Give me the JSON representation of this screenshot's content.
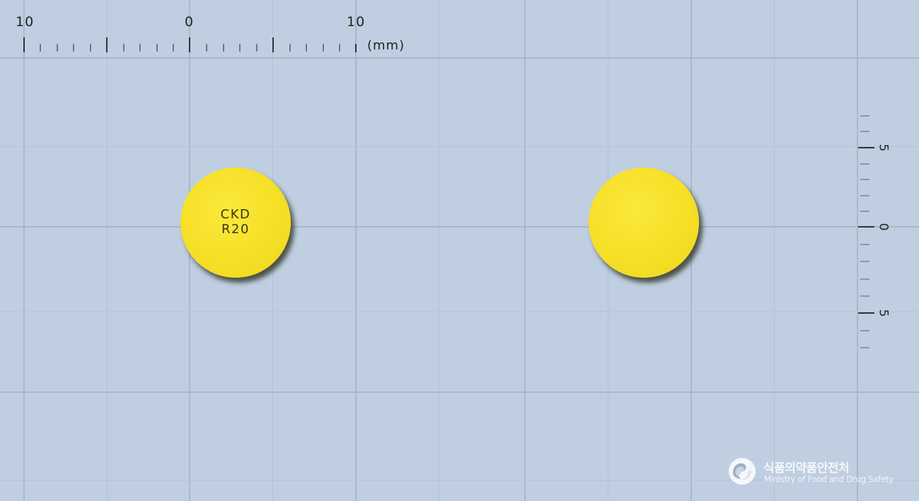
{
  "top_ruler": {
    "labels": [
      "10",
      "0",
      "10"
    ],
    "unit": "(mm)"
  },
  "side_ruler": {
    "labels": [
      "5",
      "0",
      "5"
    ]
  },
  "tablets": [
    {
      "imprint_line1": "CKD",
      "imprint_line2": "R20",
      "color": "#f6e027",
      "side": "front"
    },
    {
      "imprint_line1": "",
      "imprint_line2": "",
      "color": "#f6e027",
      "side": "back"
    }
  ],
  "logo": {
    "name_ko": "식품의약품안전처",
    "name_en": "Ministry of Food and Drug Safety",
    "icon": "taeguk-emblem-icon"
  },
  "colors": {
    "background": "#bfcfe1",
    "grid": "#a7b8cb",
    "tablet": "#f6e027"
  }
}
